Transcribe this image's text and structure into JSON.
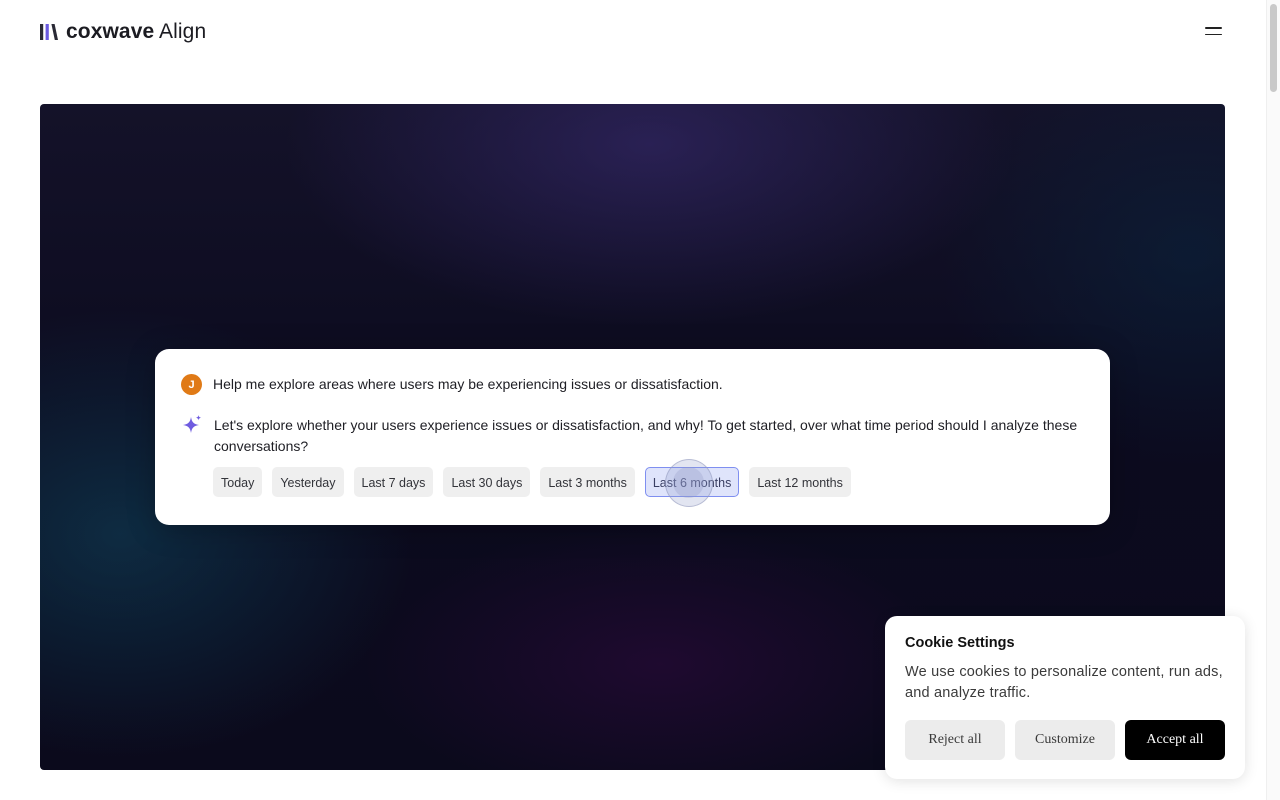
{
  "header": {
    "brand": "coxwave",
    "product": "Align",
    "menu_icon": "hamburger-icon"
  },
  "chat": {
    "user_avatar_initial": "J",
    "user_message": "Help me explore areas where users may be experiencing issues or dissatisfaction.",
    "ai_icon": "sparkle-icon",
    "ai_message": "Let's explore whether your users experience issues or dissatisfaction, and why! To get started, over what time period should I analyze these conversations?",
    "time_options": [
      "Today",
      "Yesterday",
      "Last 7 days",
      "Last 30 days",
      "Last 3 months",
      "Last 6 months",
      "Last 12 months"
    ],
    "selected_option": "Last 6 months"
  },
  "cookie": {
    "title": "Cookie Settings",
    "text": "We use cookies to personalize content, run ads, and analyze traffic.",
    "reject_label": "Reject all",
    "customize_label": "Customize",
    "accept_label": "Accept all"
  },
  "colors": {
    "avatar": "#e07a16",
    "sparkle": "#6f5ce0",
    "selected_chip_bg": "#dfe4fb",
    "selected_chip_border": "#7f8ff0",
    "hero_bg": "#0c0b1f",
    "accept_button": "#000000"
  }
}
